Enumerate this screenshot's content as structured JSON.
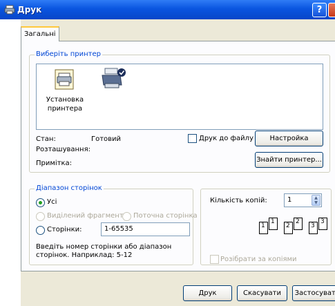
{
  "window": {
    "title": "Друк",
    "help_glyph": "?"
  },
  "tabs": [
    {
      "label": "Загальні"
    }
  ],
  "printer_group": {
    "legend": "Виберіть принтер",
    "items": [
      {
        "label": "Установка принтера",
        "icon": "add-printer-icon"
      },
      {
        "label": "",
        "icon": "default-printer-icon"
      }
    ],
    "status_label": "Стан:",
    "status_value": "Готовий",
    "location_label": "Розташування:",
    "comment_label": "Примітка:",
    "print_to_file_label": "Друк до файлу",
    "print_to_file_checked": false,
    "setup_button": "Настройка",
    "find_button": "Знайти принтер..."
  },
  "page_range": {
    "legend": "Діапазон сторінок",
    "all_label": "Усі",
    "selection_label": "Виділений фрагмент",
    "current_page_label": "Поточна сторінка",
    "pages_label": "Сторінки:",
    "pages_value": "1-65535",
    "selected": "all",
    "hint": "Введіть номер сторінки або діапазон сторінок.  Наприклад: 5-12"
  },
  "copies": {
    "label": "Кількість копій:",
    "value": "1",
    "collate_label": "Розібрати за копіями",
    "collate_checked": false,
    "collate_pages": [
      "1",
      "1",
      "2",
      "2",
      "3",
      "3"
    ]
  },
  "buttons": {
    "print": "Друк",
    "cancel": "Скасувати",
    "apply": "Застосувати"
  },
  "colors": {
    "title_bar": "#0a55e0",
    "legend_text": "#0046d5",
    "disabled_text": "#aca899",
    "tab_highlight": "#ffc83c"
  }
}
